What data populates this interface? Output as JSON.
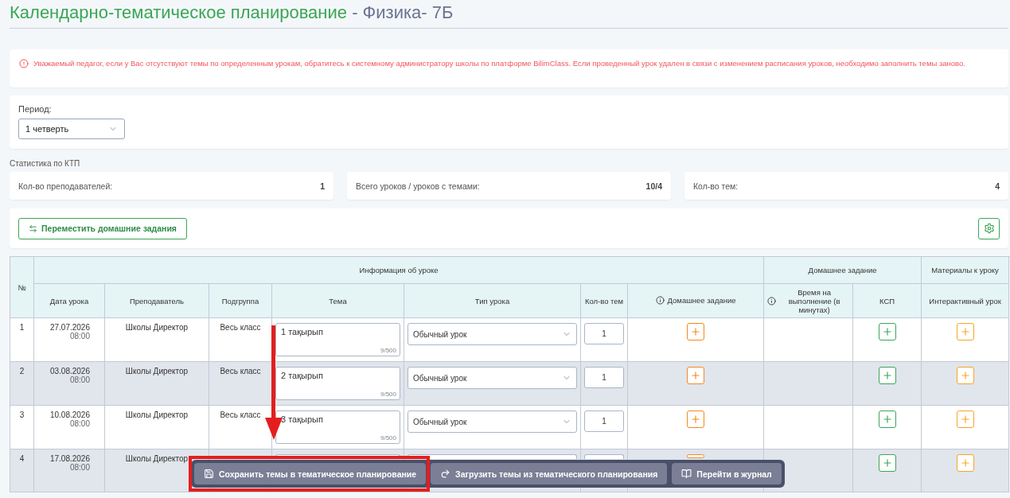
{
  "title": {
    "main": "Календарно-тематическое планирование",
    "subject": "- Физика- 7Б"
  },
  "alert": "Уважаемый педагог, если у Вас отсутствуют темы по определенным урокам, обратитесь к системному администратору школы по платформе BilimClass. Если проведенный урок удален в связи с изменением расписания уроков, необходимо заполнить темы заново.",
  "period": {
    "label": "Период:",
    "value": "1 четверть"
  },
  "stats": {
    "title": "Статистика по КТП",
    "items": [
      {
        "label": "Кол-во преподавателей:",
        "value": "1"
      },
      {
        "label": "Всего уроков / уроков с темами:",
        "value": "10/4"
      },
      {
        "label": "Кол-во тем:",
        "value": "4"
      }
    ]
  },
  "toolbar": {
    "move_button": "Переместить домашние задания"
  },
  "table": {
    "number_header": "№",
    "groups": [
      {
        "label": "Информация об уроке"
      },
      {
        "label": "Домашнее задание"
      },
      {
        "label": "Материалы к уроку"
      }
    ],
    "columns": [
      {
        "label": "Дата урока",
        "info": false
      },
      {
        "label": "Преподаватель",
        "info": false
      },
      {
        "label": "Подгруппа",
        "info": false
      },
      {
        "label": "Тема",
        "info": false
      },
      {
        "label": "Тип урока",
        "info": false
      },
      {
        "label": "Кол-во тем",
        "info": false
      },
      {
        "label": "Домашнее задание",
        "info": true
      },
      {
        "label": "Время на выполнение (в минутах)",
        "info": true
      },
      {
        "label": "КСП",
        "info": false
      },
      {
        "label": "Интерактивный урок",
        "info": false
      }
    ],
    "rows": [
      {
        "number": "1",
        "date": "27.07.2026",
        "time": "08:00",
        "teacher": "Школы Директор",
        "subgroup": "Весь класс",
        "topic": "1 тақырып",
        "counter": "9/500",
        "lesson_type": "Обычный урок",
        "topic_count": "1"
      },
      {
        "number": "2",
        "date": "03.08.2026",
        "time": "08:00",
        "teacher": "Школы Директор",
        "subgroup": "Весь класс",
        "topic": "2 тақырып",
        "counter": "9/500",
        "lesson_type": "Обычный урок",
        "topic_count": "1"
      },
      {
        "number": "3",
        "date": "10.08.2026",
        "time": "08:00",
        "teacher": "Школы Директор",
        "subgroup": "Весь класс",
        "topic": "3 тақырып",
        "counter": "9/500",
        "lesson_type": "Обычный урок",
        "topic_count": "1"
      },
      {
        "number": "4",
        "date": "17.08.2026",
        "time": "08:00",
        "teacher": "Школы Директор"
      }
    ]
  },
  "action_bar": {
    "buttons": [
      {
        "kind": "save",
        "label": "Сохранить темы в тематическое планирование",
        "highlighted": true
      },
      {
        "kind": "load",
        "label": "Загрузить темы из тематического планирования",
        "highlighted": false
      },
      {
        "kind": "journal",
        "label": "Перейти в журнал",
        "highlighted": false
      }
    ]
  }
}
